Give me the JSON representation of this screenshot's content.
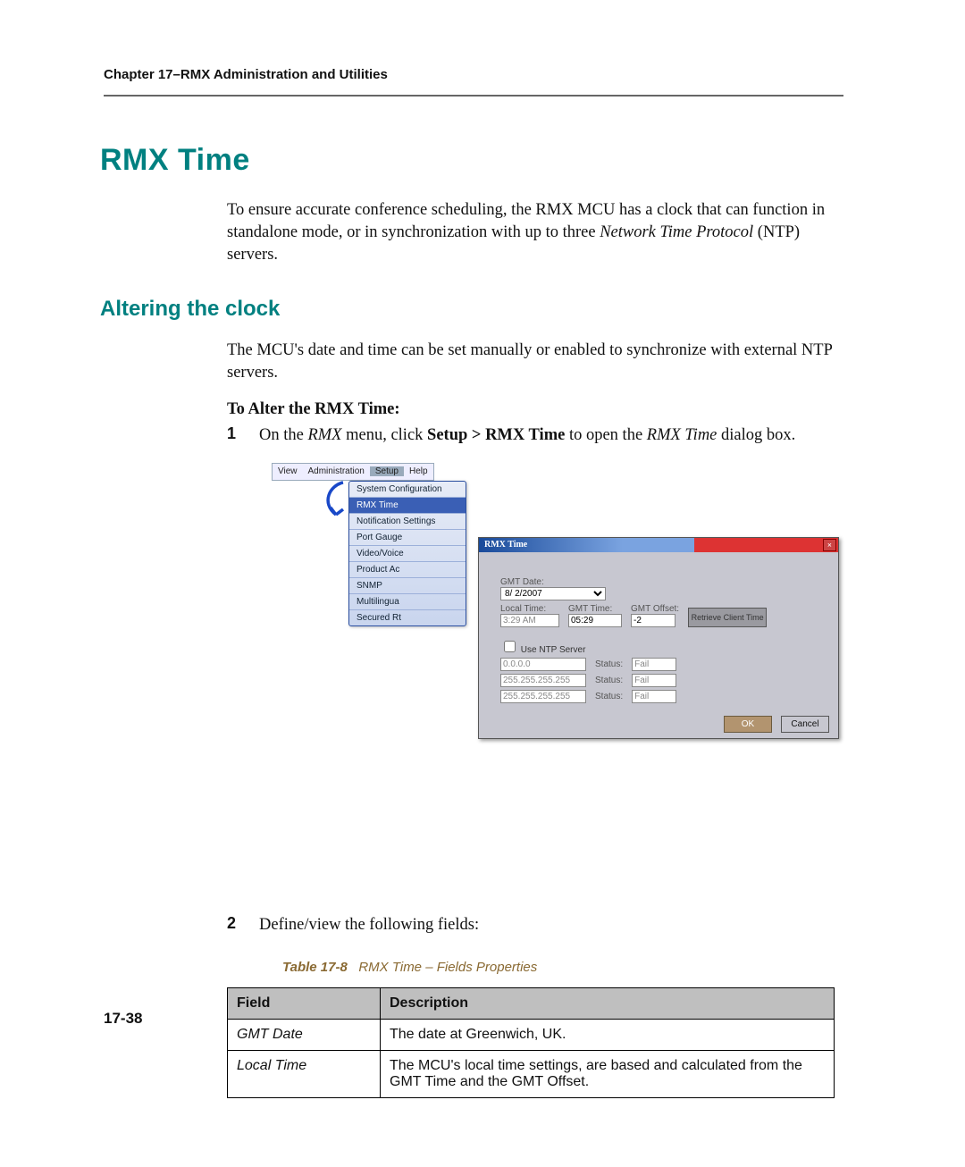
{
  "header": {
    "running_head": "Chapter 17–RMX Administration and Utilities"
  },
  "h1": "RMX Time",
  "intro": {
    "p1a": "To ensure accurate conference scheduling, the RMX MCU has a clock that can function in standalone mode, or in synchronization with up to three ",
    "ntp_em": "Network Time Protocol",
    "p1b": " (NTP) servers."
  },
  "h2": "Altering the clock",
  "p2": "The MCU's date and time can be set manually or enabled to synchronize with external NTP servers.",
  "proc_head": "To Alter the RMX Time:",
  "steps": {
    "s1": {
      "num": "1",
      "a": "On the ",
      "em1": "RMX",
      "b": " menu, click ",
      "strong": "Setup > RMX Time",
      "c": " to open the ",
      "em2": "RMX Time",
      "d": " dialog box."
    },
    "s2": {
      "num": "2",
      "text": "Define/view the following fields:"
    }
  },
  "shot": {
    "menubar": {
      "items": [
        "View",
        "Administration",
        "Setup",
        "Help"
      ],
      "active_index": 2
    },
    "dropdown": [
      "System Configuration",
      "RMX Time",
      "Notification Settings",
      "Port Gauge",
      "Video/Voice",
      "Product Ac",
      "SNMP",
      "Multilingua",
      "Secured Rt"
    ],
    "dropdown_selected_index": 1,
    "dialog": {
      "title": "RMX Time",
      "labels": {
        "gmt_date": "GMT Date:",
        "local_time": "Local Time:",
        "gmt_time": "GMT Time:",
        "gmt_offset": "GMT Offset:"
      },
      "values": {
        "gmt_date": "8/ 2/2007",
        "local_time": "3:29 AM",
        "gmt_time": "05:29",
        "gmt_offset": "-2"
      },
      "retrieve_btn": "Retrieve Client Time",
      "use_ntp": "Use NTP Server",
      "ntp": [
        {
          "addr": "0.0.0.0",
          "status_lbl": "Status:",
          "status": "Fail"
        },
        {
          "addr": "255.255.255.255",
          "status_lbl": "Status:",
          "status": "Fail"
        },
        {
          "addr": "255.255.255.255",
          "status_lbl": "Status:",
          "status": "Fail"
        }
      ],
      "ok": "OK",
      "cancel": "Cancel"
    }
  },
  "table": {
    "caption_num": "Table 17-8",
    "caption_text": "RMX Time – Fields Properties",
    "cols": [
      "Field",
      "Description"
    ],
    "rows": [
      {
        "f": "GMT Date",
        "d": "The date at Greenwich, UK."
      },
      {
        "f": "Local Time",
        "d": "The MCU's local time settings, are based and calculated from the GMT Time and the GMT Offset."
      }
    ]
  },
  "pagenum": "17-38"
}
